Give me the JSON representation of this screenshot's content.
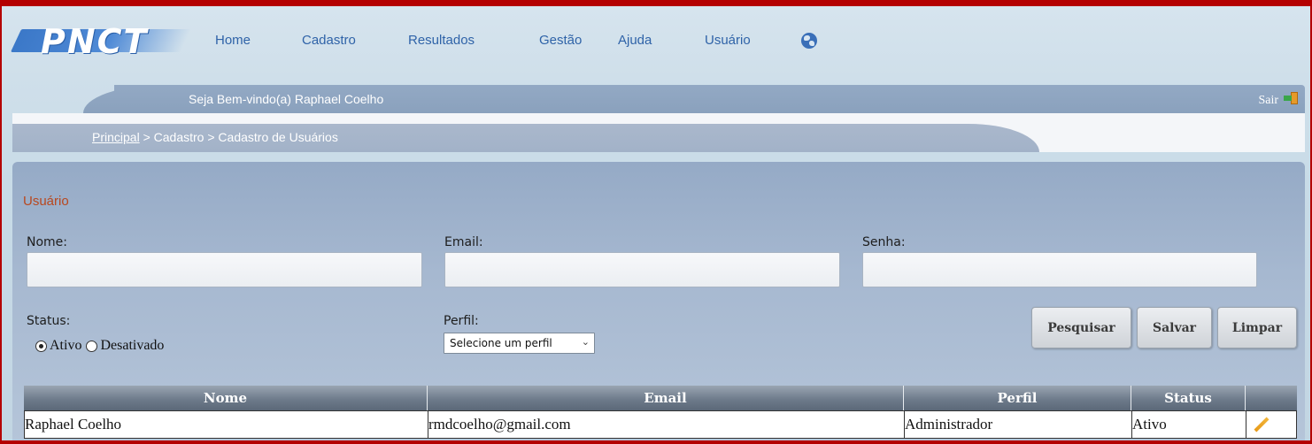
{
  "app": {
    "logo_text": "PNCT"
  },
  "nav": {
    "items": [
      {
        "label": "Home"
      },
      {
        "label": "Cadastro"
      },
      {
        "label": "Resultados"
      },
      {
        "label": "Gestão"
      },
      {
        "label": "Ajuda"
      },
      {
        "label": "Usuário"
      }
    ],
    "globe_icon": "globe-icon"
  },
  "header": {
    "welcome": "Seja Bem-vindo(a) Raphael Coelho",
    "logout_label": "Sair",
    "logout_icon": "exit-door-icon"
  },
  "breadcrumb": {
    "root": "Principal",
    "rest": " > Cadastro > Cadastro de Usuários"
  },
  "form": {
    "section_title": "Usuário",
    "nome_label": "Nome:",
    "nome_value": "",
    "email_label": "Email:",
    "email_value": "",
    "senha_label": "Senha:",
    "senha_value": "",
    "status_label": "Status:",
    "status_options": [
      {
        "label": "Ativo",
        "checked": true
      },
      {
        "label": "Desativado",
        "checked": false
      }
    ],
    "perfil_label": "Perfil:",
    "perfil_selected": "Selecione um perfil"
  },
  "buttons": {
    "pesquisar": "Pesquisar",
    "salvar": "Salvar",
    "limpar": "Limpar"
  },
  "table": {
    "columns": [
      "Nome",
      "Email",
      "Perfil",
      "Status",
      ""
    ],
    "rows": [
      {
        "nome": "Raphael Coelho",
        "email": "rmdcoelho@gmail.com",
        "perfil": "Administrador",
        "status": "Ativo",
        "action_icon": "pencil-icon"
      }
    ]
  },
  "colors": {
    "frame_red": "#b40000",
    "nav_link": "#2f63a8",
    "section_title": "#b8481f",
    "panel": "#a6b8d0"
  }
}
